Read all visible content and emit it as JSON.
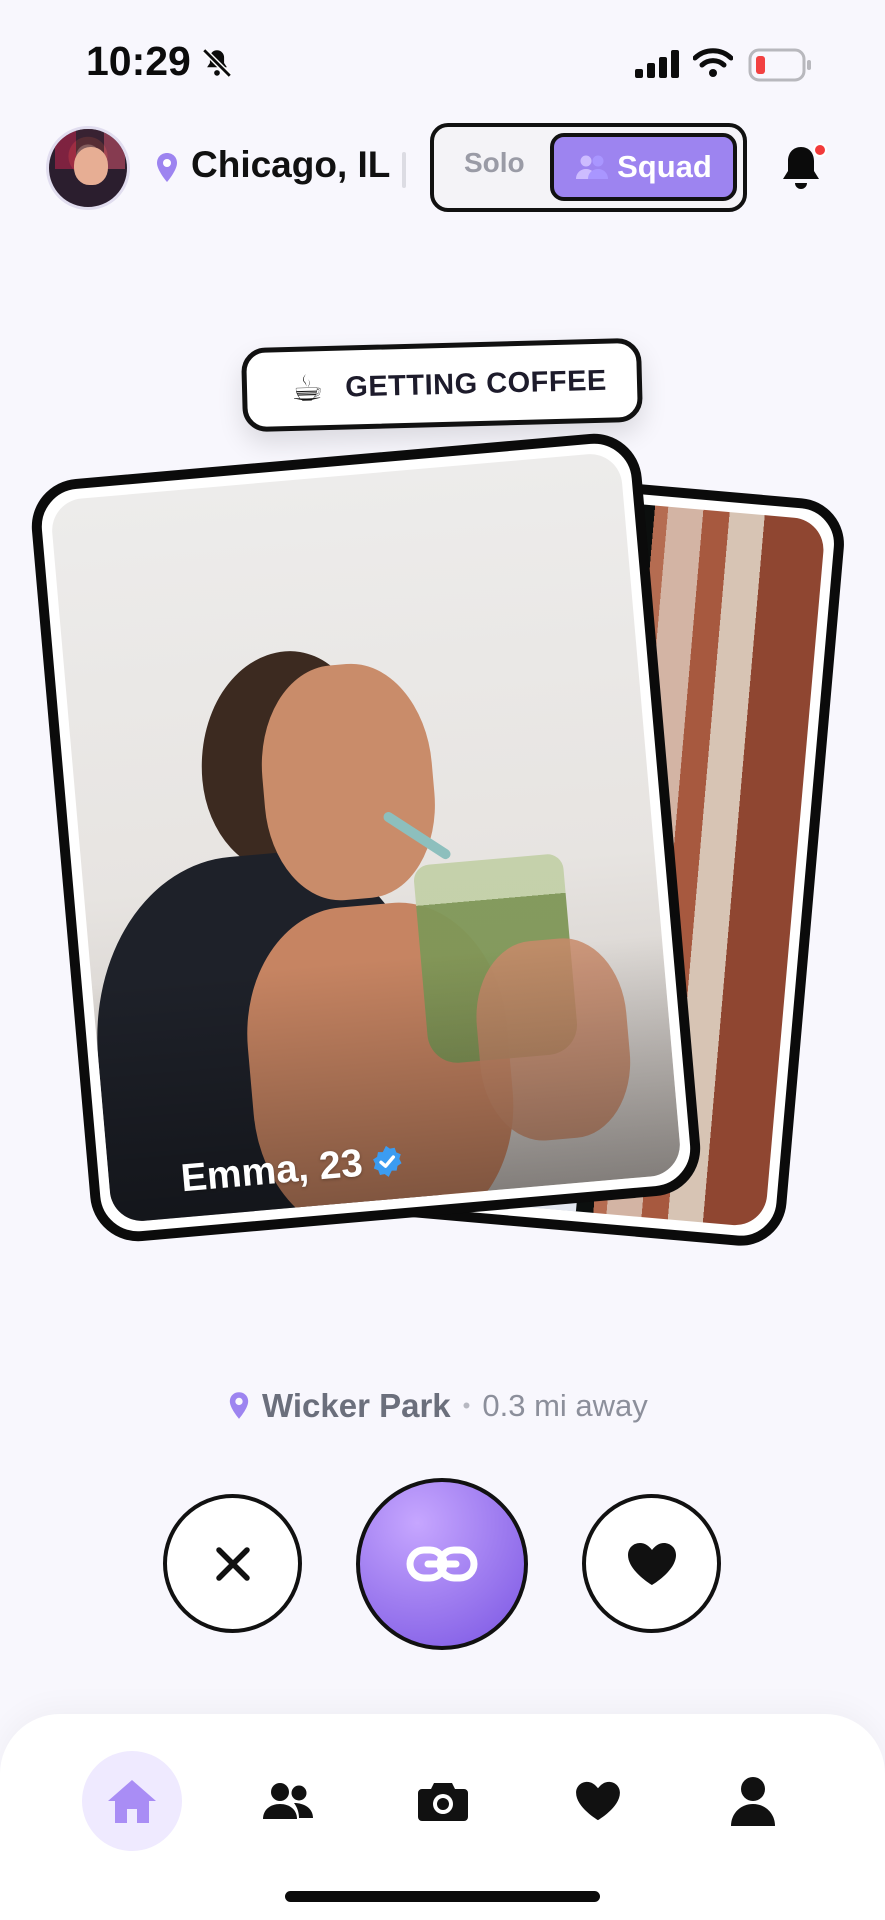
{
  "status_bar": {
    "time": "10:29"
  },
  "header": {
    "location": "Chicago, IL",
    "mode_toggle": {
      "options": [
        "Solo",
        "Squad"
      ],
      "selected": "Squad"
    },
    "notifications": {
      "has_unread": true
    }
  },
  "activity": {
    "emoji": "☕",
    "label": "GETTING COFFEE"
  },
  "profile": {
    "name_age": "Emma, 23",
    "verified": true,
    "neighborhood": "Wicker Park",
    "separator": "•",
    "distance": "0.3 mi away"
  },
  "actions": [
    "pass",
    "connect",
    "like"
  ],
  "tabs": [
    {
      "name": "home",
      "active": true
    },
    {
      "name": "friends",
      "active": false
    },
    {
      "name": "camera",
      "active": false
    },
    {
      "name": "likes",
      "active": false
    },
    {
      "name": "profile",
      "active": false
    }
  ],
  "colors": {
    "accent": "#9d84f0",
    "badge": "#f23a3a",
    "verified": "#3b9cf1"
  }
}
